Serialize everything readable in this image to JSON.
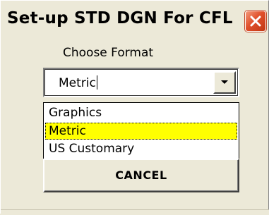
{
  "window": {
    "title": "Set-up STD DGN For CFL"
  },
  "form": {
    "choose_label": "Choose Format",
    "combo_value": "Metric",
    "options": [
      "Graphics",
      "Metric",
      "US Customary"
    ],
    "selected_index": 1,
    "cancel_label": "CANCEL"
  },
  "icons": {
    "close": "close-icon",
    "dropdown_arrow": "chevron-down-icon"
  },
  "colors": {
    "selection_highlight": "#ffff00",
    "close_button": "#e0502c",
    "dialog_face": "#ece9d8"
  }
}
